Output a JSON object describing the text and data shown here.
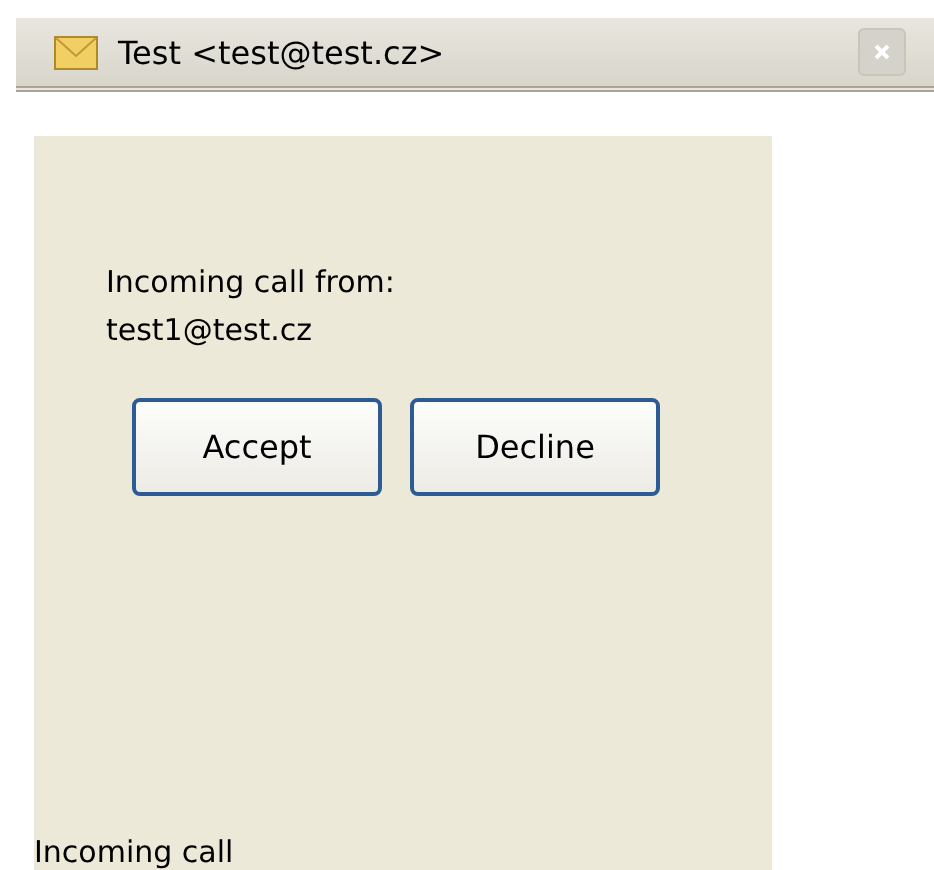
{
  "window": {
    "title": "Test <test@test.cz>"
  },
  "message": {
    "line_1": "Incoming call from:",
    "line_2": "test1@test.cz"
  },
  "buttons": [
    {
      "label": "Accept"
    },
    {
      "label": "Decline"
    }
  ],
  "status_bar": {
    "text": "Incoming call"
  }
}
